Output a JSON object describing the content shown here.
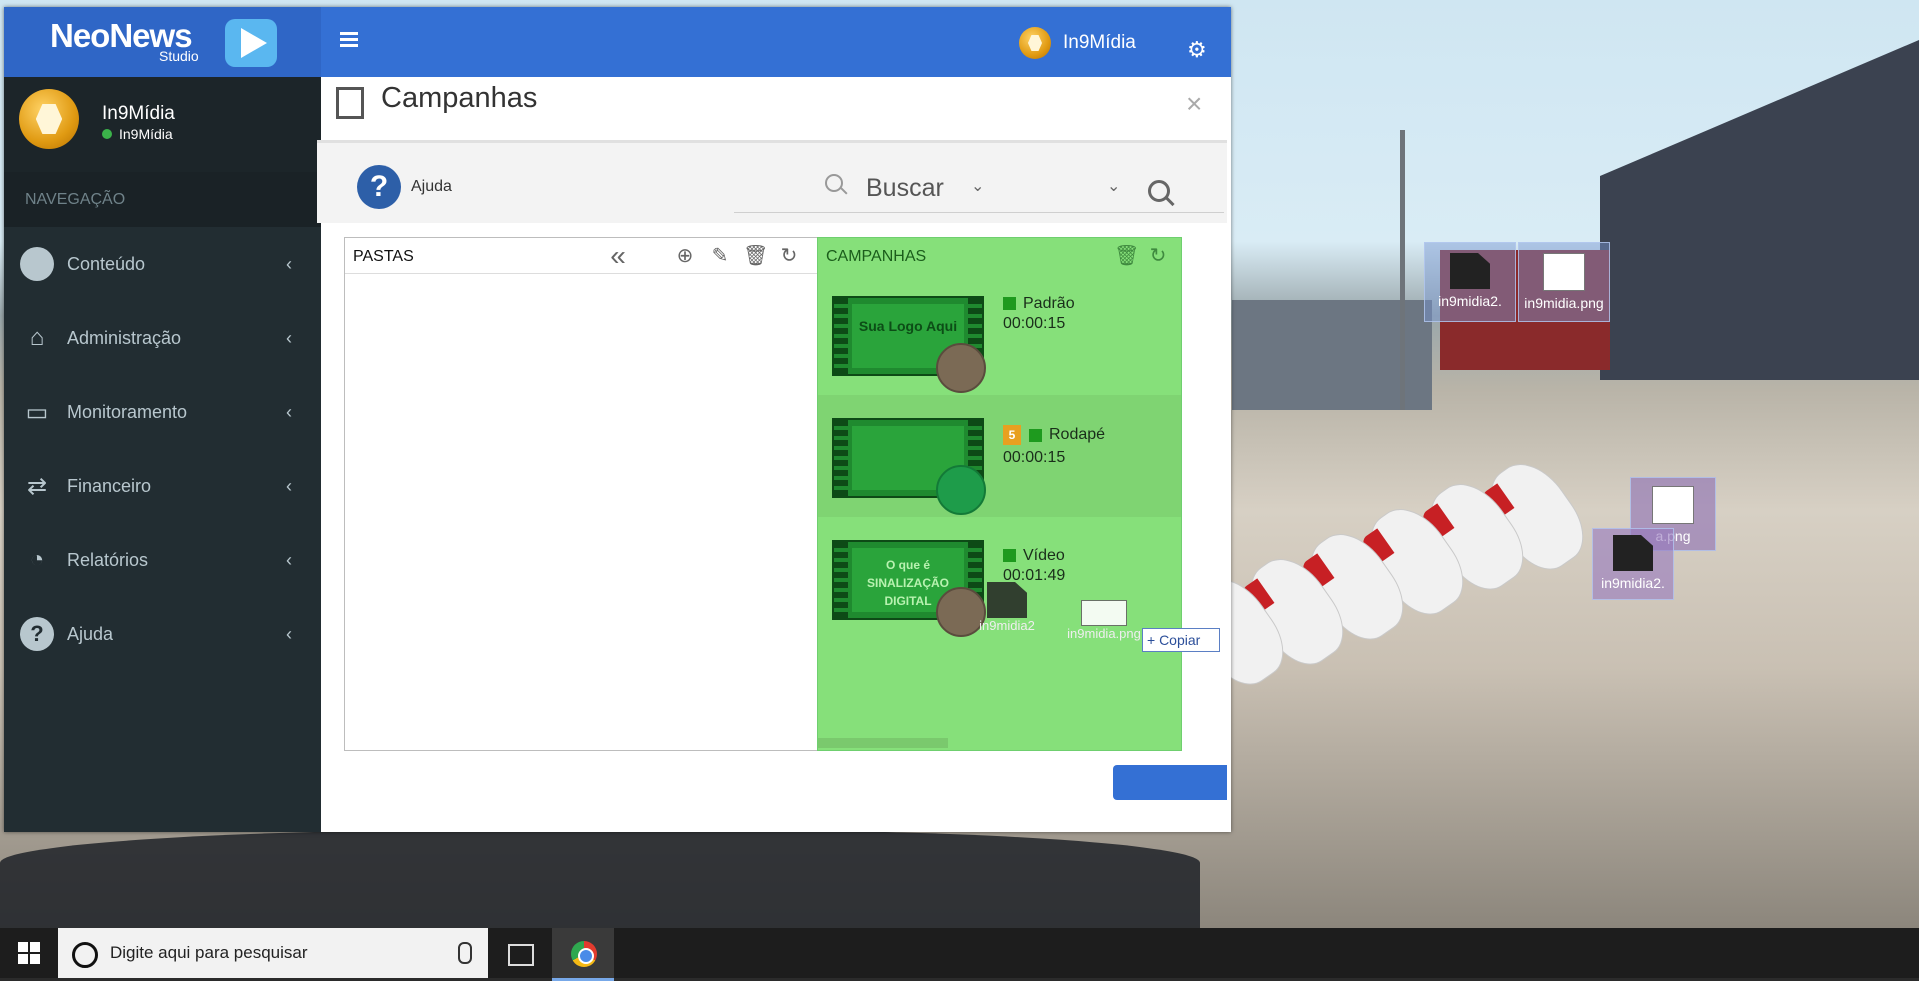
{
  "app": {
    "logo_text": "NeoNews",
    "logo_sub": "Studio",
    "top_user": "In9Mídia"
  },
  "sidebar": {
    "user_name": "In9Mídia",
    "user_status": "In9Mídia",
    "nav_header": "NAVEGAÇÃO",
    "items": [
      {
        "label": "Conteúdo",
        "icon": "play-circle-icon"
      },
      {
        "label": "Administração",
        "icon": "home-icon"
      },
      {
        "label": "Monitoramento",
        "icon": "monitor-icon"
      },
      {
        "label": "Financeiro",
        "icon": "exchange-icon"
      },
      {
        "label": "Relatórios",
        "icon": "pie-chart-icon"
      },
      {
        "label": "Ajuda",
        "icon": "question-circle-icon"
      }
    ]
  },
  "panel": {
    "title": "Campanhas",
    "help_label": "Ajuda",
    "search_label": "Buscar"
  },
  "pastas": {
    "title": "PASTAS"
  },
  "campanhas": {
    "title": "CAMPANHAS",
    "items": [
      {
        "name": "Padrão",
        "duration": "00:00:15",
        "thumb_text": "Sua Logo Aqui"
      },
      {
        "name": "Rodapé",
        "duration": "00:00:15",
        "thumb_text": ""
      },
      {
        "name": "Vídeo",
        "duration": "00:01:49",
        "thumb_text": "O que é SINALIZAÇÃO DIGITAL"
      }
    ]
  },
  "drag": {
    "file1": "in9midia2",
    "file2": "in9midia.png",
    "copy_tip": "+ Copiar"
  },
  "desktop": {
    "icons": [
      {
        "label": "in9midia2."
      },
      {
        "label": "in9midia.png"
      },
      {
        "label": "a.png"
      },
      {
        "label": "in9midia2."
      }
    ]
  },
  "taskbar": {
    "search_placeholder": "Digite aqui para pesquisar"
  },
  "colors": {
    "topbar": "#3470d4",
    "sidebar": "#222d32",
    "campaign_bg": "#86e07a"
  }
}
